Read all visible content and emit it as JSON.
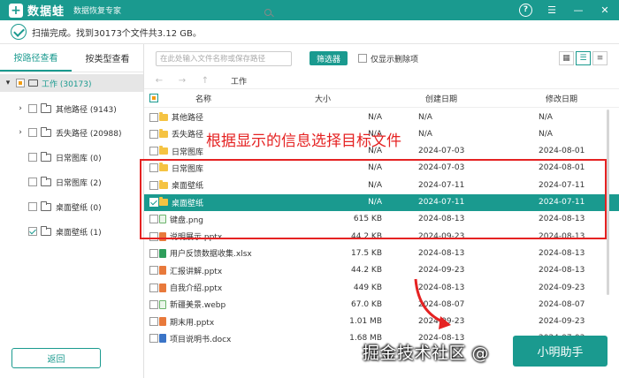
{
  "app": {
    "logo_glyph": "+",
    "name": "数据蛙",
    "subtitle": "数据恢复专家"
  },
  "window_controls": [
    "help-icon",
    "menu-icon",
    "minimize-icon",
    "close-icon"
  ],
  "status": {
    "text": "扫描完成。找到30173个文件共3.12 GB。"
  },
  "left_tabs": [
    {
      "label": "按路径查看",
      "active": true
    },
    {
      "label": "按类型查看",
      "active": false
    }
  ],
  "tree": [
    {
      "label": "工作 (30173)",
      "expander": "▾",
      "check": "partial",
      "icon": "drive",
      "selected": true
    },
    {
      "label": "其他路径 (9143)",
      "expander": "›",
      "check": "none",
      "icon": "folder"
    },
    {
      "label": "丢失路径 (20988)",
      "expander": "›",
      "check": "none",
      "icon": "folder"
    },
    {
      "label": "日常图库 (0)",
      "expander": "",
      "check": "none",
      "icon": "folder"
    },
    {
      "label": "日常图库 (2)",
      "expander": "",
      "check": "none",
      "icon": "folder"
    },
    {
      "label": "桌面壁纸 (0)",
      "expander": "",
      "check": "none",
      "icon": "folder"
    },
    {
      "label": "桌面壁纸 (1)",
      "expander": "",
      "check": "checked",
      "icon": "folder"
    }
  ],
  "back_button": "返回",
  "search": {
    "placeholder": "在此处输入文件名称或保存路径"
  },
  "filter_button": "筛选器",
  "deleted_only": "仅显示删除项",
  "breadcrumb": "工作",
  "columns": {
    "name": "名称",
    "size": "大小",
    "created": "创建日期",
    "modified": "修改日期"
  },
  "files": [
    {
      "name": "其他路径",
      "type": "folder",
      "size": "N/A",
      "created": "N/A",
      "modified": "N/A",
      "checked": false,
      "selected": false
    },
    {
      "name": "丢失路径",
      "type": "folder",
      "size": "N/A",
      "created": "N/A",
      "modified": "N/A",
      "checked": false,
      "selected": false
    },
    {
      "name": "日常图库",
      "type": "folder",
      "size": "N/A",
      "created": "2024-07-03",
      "modified": "2024-08-01",
      "checked": false,
      "selected": false
    },
    {
      "name": "日常图库",
      "type": "folder",
      "size": "N/A",
      "created": "2024-07-03",
      "modified": "2024-08-01",
      "checked": false,
      "selected": false
    },
    {
      "name": "桌面壁纸",
      "type": "folder",
      "size": "N/A",
      "created": "2024-07-11",
      "modified": "2024-07-11",
      "checked": false,
      "selected": false
    },
    {
      "name": "桌面壁纸",
      "type": "folder",
      "size": "N/A",
      "created": "2024-07-11",
      "modified": "2024-07-11",
      "checked": true,
      "selected": true
    },
    {
      "name": "键盘.png",
      "type": "img",
      "size": "615 KB",
      "created": "2024-08-13",
      "modified": "2024-08-13",
      "checked": false,
      "selected": false
    },
    {
      "name": "说明展示.pptx",
      "type": "ppt",
      "size": "44.2 KB",
      "created": "2024-09-23",
      "modified": "2024-08-13",
      "checked": false,
      "selected": false
    },
    {
      "name": "用户反馈数据收集.xlsx",
      "type": "xlsx",
      "size": "17.5 KB",
      "created": "2024-08-13",
      "modified": "2024-08-13",
      "checked": false,
      "selected": false
    },
    {
      "name": "汇报讲解.pptx",
      "type": "ppt",
      "size": "44.2 KB",
      "created": "2024-09-23",
      "modified": "2024-08-13",
      "checked": false,
      "selected": false
    },
    {
      "name": "自我介绍.pptx",
      "type": "ppt",
      "size": "449 KB",
      "created": "2024-08-13",
      "modified": "2024-09-23",
      "checked": false,
      "selected": false
    },
    {
      "name": "新疆美景.webp",
      "type": "webp",
      "size": "67.0 KB",
      "created": "2024-08-07",
      "modified": "2024-08-07",
      "checked": false,
      "selected": false
    },
    {
      "name": "期末用.pptx",
      "type": "ppt",
      "size": "1.01 MB",
      "created": "2024-09-23",
      "modified": "2024-09-23",
      "checked": false,
      "selected": false
    },
    {
      "name": "项目说明书.docx",
      "type": "docx",
      "size": "1.68 MB",
      "created": "2024-08-13",
      "modified": "2024-07-03",
      "checked": false,
      "selected": false
    }
  ],
  "annotation": {
    "text": "根据显示的信息选择目标文件",
    "color": "#e52222"
  },
  "recover_button": "小明助手",
  "watermark": "掘金技术社区 @",
  "colors": {
    "accent": "#1a9a8f",
    "annotation": "#e52222"
  }
}
